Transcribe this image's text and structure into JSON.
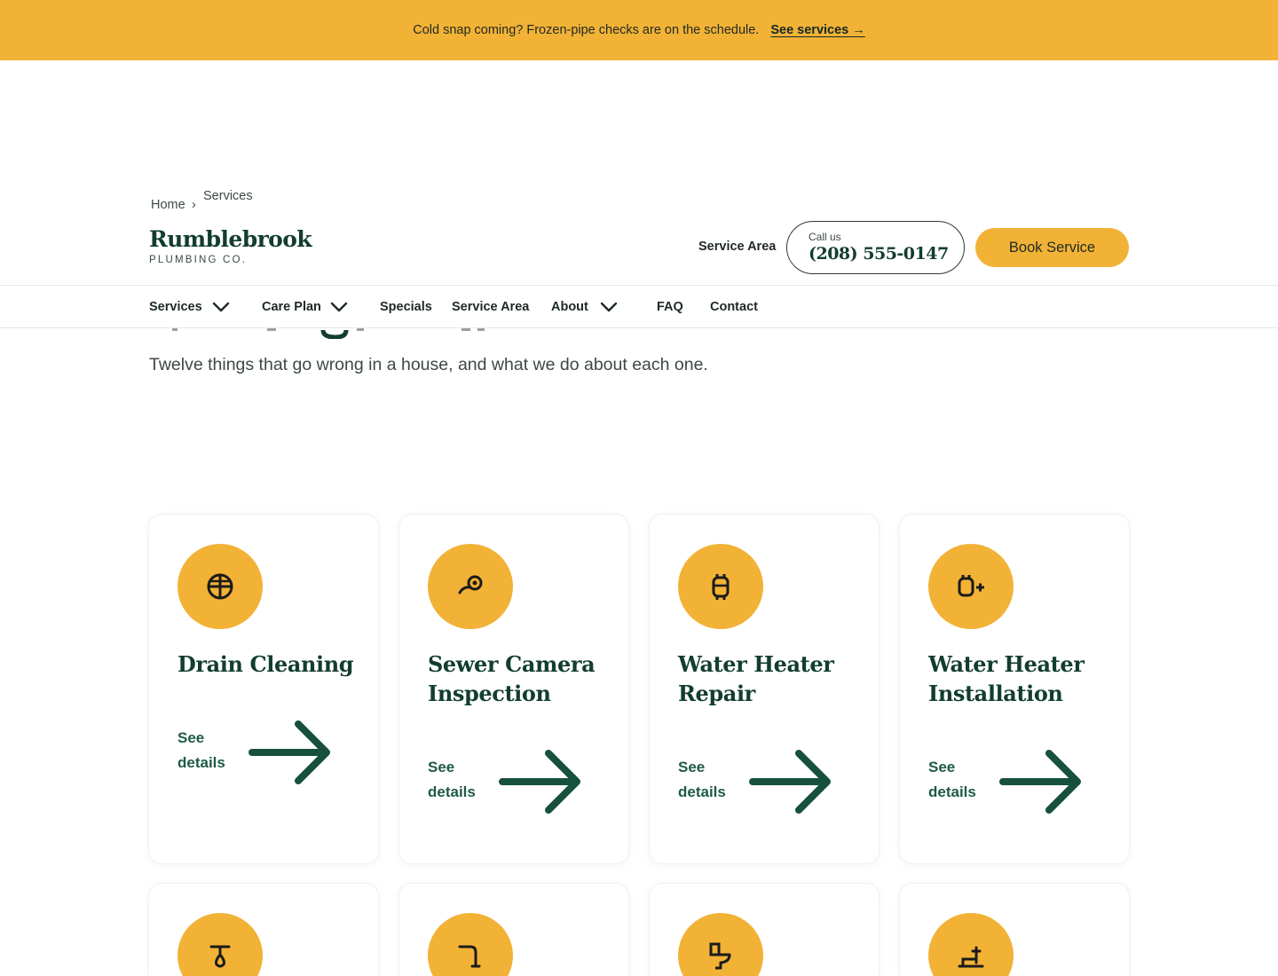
{
  "promo": {
    "text": "Cold snap coming? Frozen-pipe checks are on the schedule.",
    "link": "See services →"
  },
  "breadcrumb": {
    "home": "Home",
    "separator": "›",
    "current": "Services"
  },
  "brand": {
    "name": "Rumblebrook",
    "tagline": "PLUMBING CO."
  },
  "header": {
    "service_area_link": "Service Area",
    "call_label": "Call us",
    "phone": "(208) 555-0147",
    "book_button": "Book Service"
  },
  "nav": {
    "items": [
      {
        "label": "Services",
        "has_dropdown": true
      },
      {
        "label": "Care Plan",
        "has_dropdown": true
      },
      {
        "label": "Specials",
        "has_dropdown": false
      },
      {
        "label": "Service Area",
        "has_dropdown": false
      },
      {
        "label": "About",
        "has_dropdown": true
      },
      {
        "label": "FAQ",
        "has_dropdown": false
      },
      {
        "label": "Contact",
        "has_dropdown": false
      }
    ]
  },
  "intro": {
    "subtitle": "Twelve things that go wrong in a house, and what we do about each one."
  },
  "services": {
    "cards": [
      {
        "title": "Drain Cleaning",
        "icon": "drain-icon",
        "cta": "See details"
      },
      {
        "title": "Sewer Camera Inspection",
        "icon": "camera-icon",
        "cta": "See details"
      },
      {
        "title": "Water Heater Repair",
        "icon": "water-heater-icon",
        "cta": "See details"
      },
      {
        "title": "Water Heater Installation",
        "icon": "water-heater-add-icon",
        "cta": "See details"
      }
    ],
    "second_row_icons": [
      "faucet-icon",
      "pipe-icon",
      "toilet-icon",
      "fixture-install-icon"
    ]
  },
  "colors": {
    "accent": "#f2b236",
    "brand_green": "#123d2f",
    "link_green": "#1f5a45"
  }
}
